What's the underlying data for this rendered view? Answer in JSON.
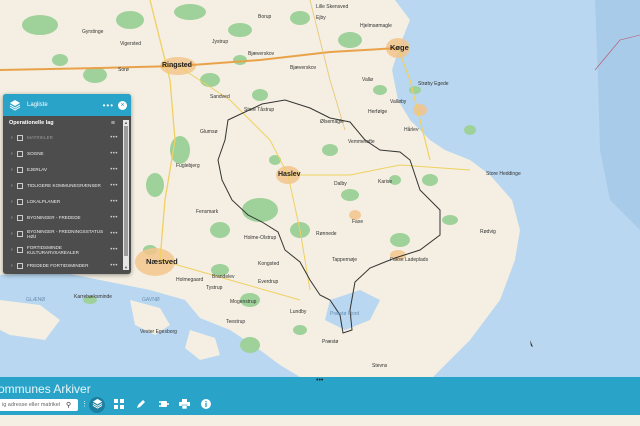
{
  "map": {
    "cities": [
      {
        "name": "Ringsted"
      },
      {
        "name": "Køge"
      },
      {
        "name": "Haslev"
      },
      {
        "name": "Næstved"
      }
    ],
    "places": [
      "Gyrstinge",
      "Vigersted",
      "Jystrup",
      "Bjæverskov",
      "Ejby",
      "Lille Skensved",
      "Borup",
      "Valløby",
      "Strøby Egede",
      "Vemmetofte",
      "Ølsemagle",
      "Dalby",
      "Karise",
      "Faxe",
      "Rønnede",
      "Holme-Olstrup",
      "Tappernøje",
      "Glumsø",
      "Sorø",
      "Fuglebjerg",
      "Hårlev",
      "Bjæverskov",
      "Fensmark",
      "Rødvig",
      "Store Heddinge",
      "Vallø",
      "Herfølge",
      "Fakse Ladeplads",
      "Karrebæksminde",
      "Holmegaard",
      "Tystrup",
      "Store Tåstrup",
      "Sandved",
      "Brandelev",
      "Everdrup",
      "Præstø",
      "Stevns",
      "Kongsted",
      "Teestrup",
      "Vester Egesborg",
      "Mogenstrup",
      "Lundby",
      "Hjelmsømagle"
    ],
    "sea_labels": [
      "GLÆNØ",
      "GAVNØ",
      "Præstø Fjord"
    ]
  },
  "layer_panel": {
    "title": "Lagliste",
    "more": "•••",
    "close": "×",
    "section_title": "Operationelle lag",
    "layers": [
      {
        "label": "MATRIKLER",
        "enabled": false
      },
      {
        "label": "SOGNE",
        "enabled": true
      },
      {
        "label": "EJERLAV",
        "enabled": true
      },
      {
        "label": "TIDLIGERE KOMMUNEGRÆNSER",
        "enabled": true
      },
      {
        "label": "LOKALPLANER",
        "enabled": true
      },
      {
        "label": "BYGNINGER - FREDEDE",
        "enabled": true
      },
      {
        "label": "BYGNINGER - FREDNINGSSTATUS HØJ",
        "enabled": true
      },
      {
        "label": "FORTIDSMINDE KULTURARVSAREALER",
        "enabled": true
      },
      {
        "label": "FREDEDE FORTIDSMINDER",
        "enabled": true
      }
    ]
  },
  "app": {
    "title": "e Kommunes Arkiver",
    "grip": "•••"
  },
  "search": {
    "placeholder": "ig adresse eller matrikel"
  },
  "toolbar": {
    "tools": [
      "layers",
      "basemap-gallery",
      "draw",
      "measure",
      "print",
      "about"
    ]
  },
  "colors": {
    "accent": "#2aa3c8",
    "land": "#f4efe2",
    "water": "#b9d7f0",
    "forest": "#9fd19a",
    "town": "#f3c58c",
    "panel": "#4d4d4d"
  }
}
